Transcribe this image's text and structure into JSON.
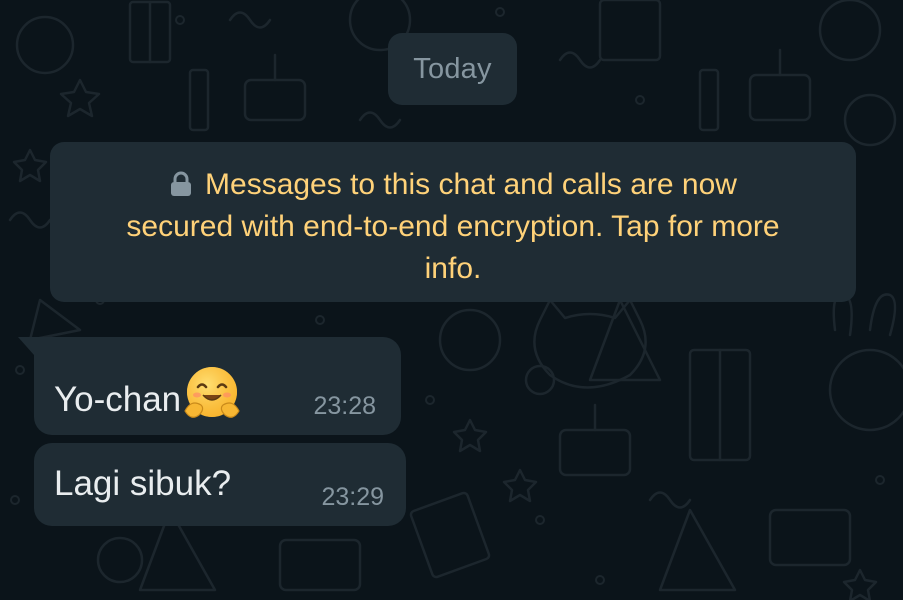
{
  "date_divider": "Today",
  "encryption_notice": {
    "icon": "lock-icon",
    "line1": "Messages to this chat and calls are now",
    "line2": "secured with end-to-end encryption. Tap for more",
    "line3": "info."
  },
  "messages": [
    {
      "text": "Yo-chan",
      "emoji": "hugging-face-icon",
      "time": "23:28",
      "direction": "incoming"
    },
    {
      "text": "Lagi sibuk?",
      "time": "23:29",
      "direction": "incoming"
    }
  ],
  "colors": {
    "background": "#0b141a",
    "bubble": "#1f2c34",
    "notice_text": "#ffd279",
    "message_text": "#e9edef",
    "meta_text": "#8696a0"
  }
}
